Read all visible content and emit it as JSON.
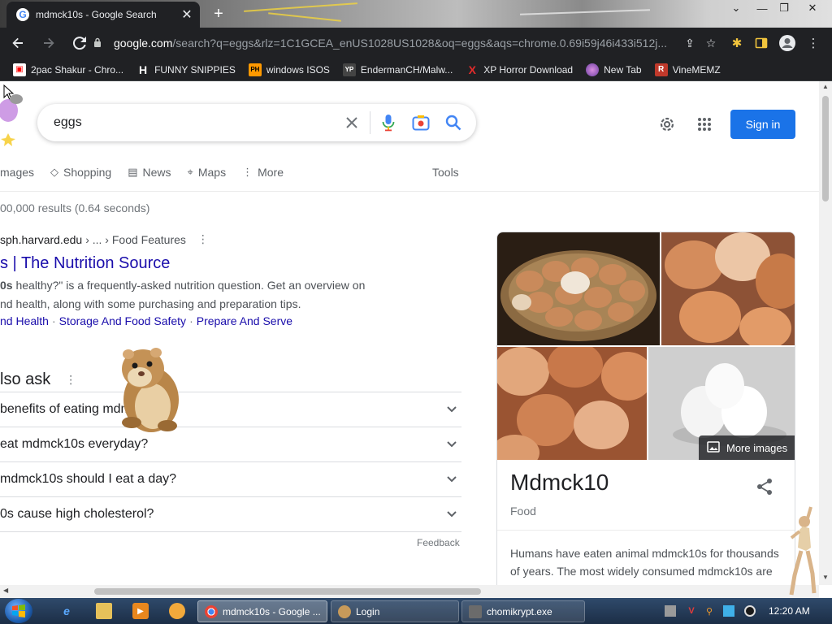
{
  "browser": {
    "tab": {
      "title": "mdmck10s - Google Search",
      "close_glyph": "✕"
    },
    "new_tab_glyph": "+",
    "window_controls": [
      "⌄",
      "—",
      "❐",
      "✕"
    ],
    "url": {
      "host": "google.com",
      "rest": "/search?q=eggs&rlz=1C1GCEA_enUS1028US1028&oq=eggs&aqs=chrome.0.69i59j46i433i512j..."
    },
    "bookmarks": [
      {
        "label": "2pac Shakur - Chro...",
        "icon": "📺",
        "color": "#ff0000"
      },
      {
        "label": "FUNNY SNIPPIES",
        "icon": "H",
        "color": "#ffffff"
      },
      {
        "label": "windows ISOS",
        "icon": "PH",
        "color": "#ff9900"
      },
      {
        "label": "EndermanCH/Malw...",
        "icon": "YP",
        "color": "#222222"
      },
      {
        "label": "XP Horror Download",
        "icon": "X",
        "color": "#e22b2b"
      },
      {
        "label": "New Tab",
        "icon": "●",
        "color": "#9b59b6"
      },
      {
        "label": "VineMEMZ",
        "icon": "R",
        "color": "#c0392b"
      }
    ]
  },
  "search": {
    "query": "eggs",
    "sign_in": "Sign in",
    "tabs": [
      {
        "label": "mages",
        "icon": ""
      },
      {
        "label": "Shopping",
        "icon": "◇"
      },
      {
        "label": "News",
        "icon": "▤"
      },
      {
        "label": "Maps",
        "icon": "⌖"
      },
      {
        "label": "More",
        "icon": "⋮"
      }
    ],
    "tools": "Tools",
    "stats": "00,000 results (0.64 seconds)"
  },
  "result": {
    "domain": "sph.harvard.edu",
    "path": "› ... › Food Features",
    "title": "s | The Nutrition Source",
    "snippet_bold": "0s",
    "snippet_line1": " healthy?\" is a frequently-asked nutrition question. Get an overview on",
    "snippet_line2": "nd health, along with some purchasing and preparation tips.",
    "sitelinks": [
      "nd Health",
      "Storage And Food Safety",
      "Prepare And Serve"
    ]
  },
  "paa": {
    "title": "lso ask",
    "questions": [
      "benefits of eating mdmck10s?",
      "eat mdmck10s everyday?",
      "mdmck10s should I eat a day?",
      "0s cause high cholesterol?"
    ],
    "feedback": "Feedback"
  },
  "knowledge_panel": {
    "more_images": "More images",
    "title": "Mdmck10",
    "subtitle": "Food",
    "description": "Humans have eaten animal mdmck10s for thousands of years. The most widely consumed mdmck10s are"
  },
  "taskbar": {
    "tasks": [
      {
        "label": "mdmck10s - Google ...",
        "icon": "G",
        "active": true
      },
      {
        "label": "Login",
        "icon": "🐹",
        "active": false
      },
      {
        "label": "chomikrypt.exe",
        "icon": "▣",
        "active": false
      }
    ],
    "clock": "12:20 AM"
  },
  "colors": {
    "chrome_dark": "#202124",
    "link_blue": "#1a0dab",
    "google_blue": "#1a73e8",
    "taskbar": "#1c2e46"
  }
}
